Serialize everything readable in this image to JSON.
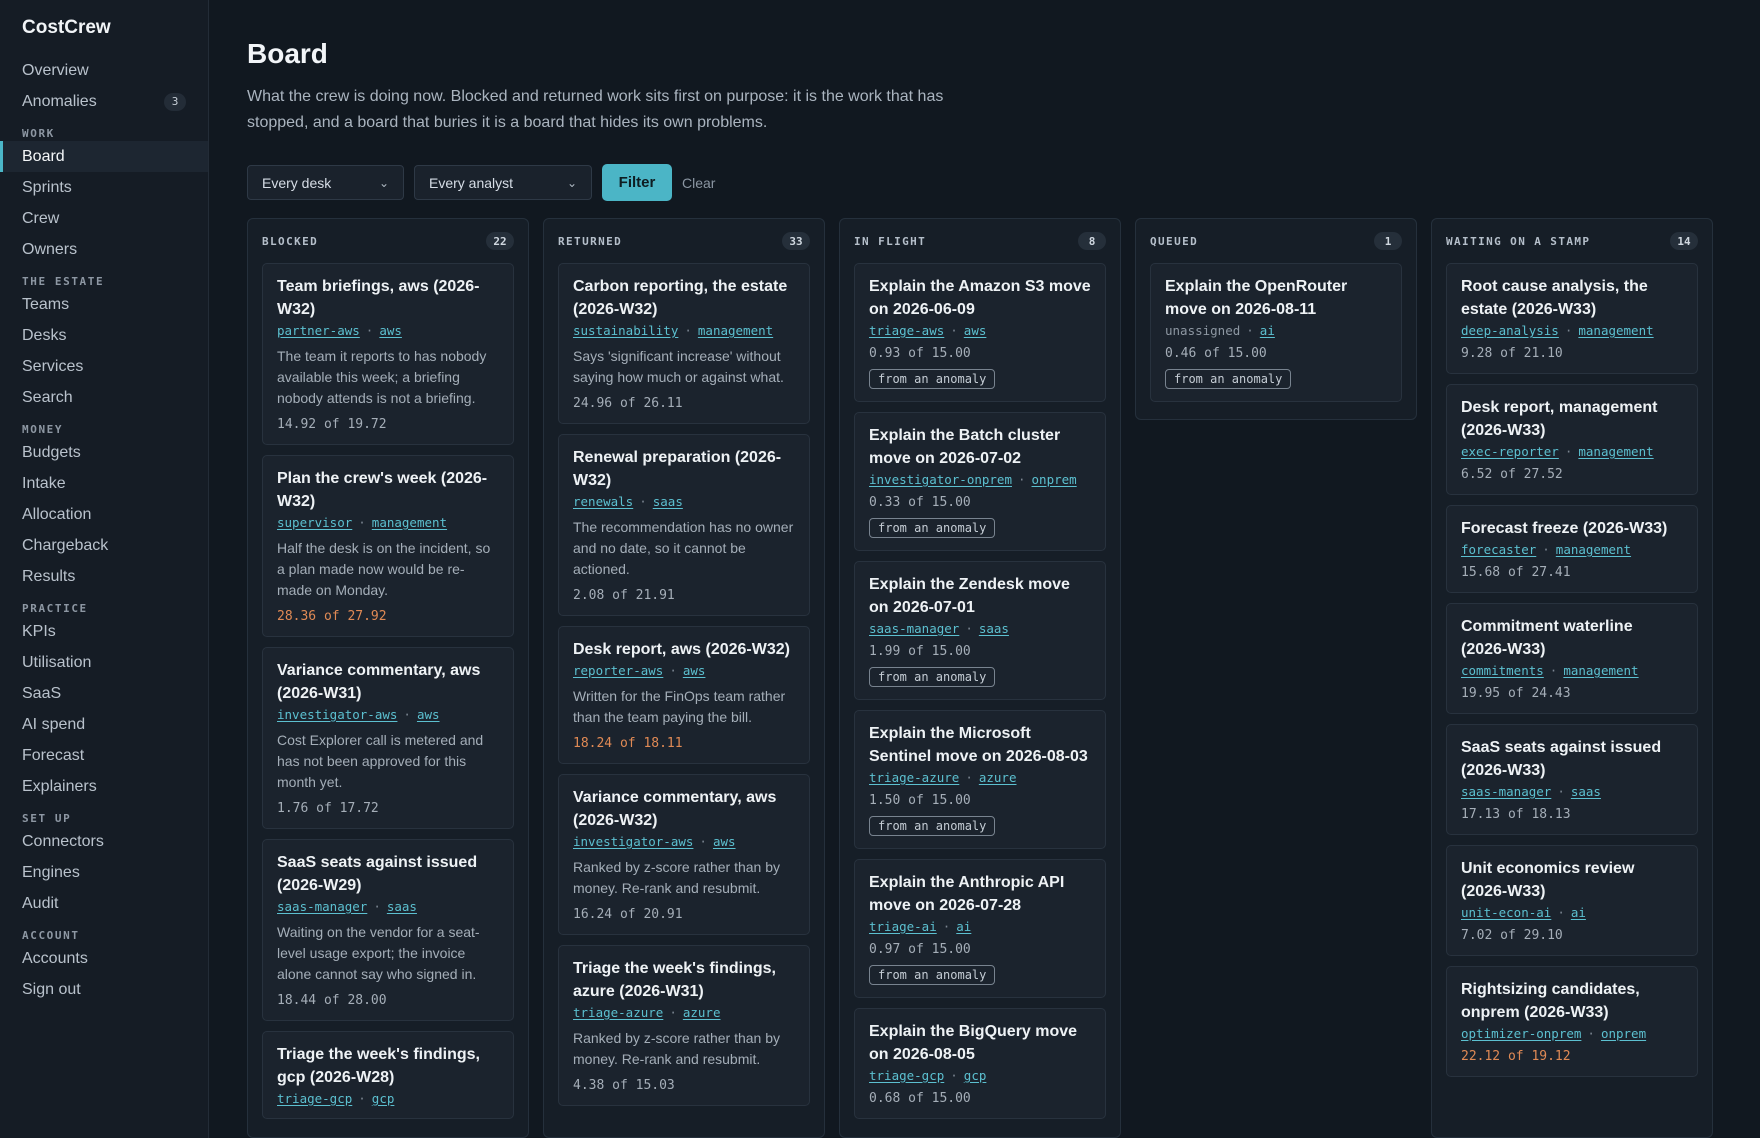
{
  "brand": "CostCrew",
  "nav": {
    "overview": "Overview",
    "anomalies": "Anomalies",
    "anomalies_count": "3",
    "sec_work": "WORK",
    "board": "Board",
    "sprints": "Sprints",
    "crew": "Crew",
    "owners": "Owners",
    "sec_estate": "THE ESTATE",
    "teams": "Teams",
    "desks": "Desks",
    "services": "Services",
    "search": "Search",
    "sec_money": "MONEY",
    "budgets": "Budgets",
    "intake": "Intake",
    "allocation": "Allocation",
    "chargeback": "Chargeback",
    "results": "Results",
    "sec_practice": "PRACTICE",
    "kpis": "KPIs",
    "utilisation": "Utilisation",
    "saas": "SaaS",
    "ai_spend": "AI spend",
    "forecast": "Forecast",
    "explainers": "Explainers",
    "sec_setup": "SET UP",
    "connectors": "Connectors",
    "engines": "Engines",
    "audit": "Audit",
    "sec_account": "ACCOUNT",
    "accounts": "Accounts",
    "sign_out": "Sign out"
  },
  "page": {
    "title": "Board",
    "intro": "What the crew is doing now. Blocked and returned work sits first on purpose: it is the work that has stopped, and a board that buries it is a board that hides its own problems."
  },
  "filters": {
    "desk": "Every desk",
    "analyst": "Every analyst",
    "filter": "Filter",
    "clear": "Clear"
  },
  "columns": [
    {
      "title": "BLOCKED",
      "count": "22",
      "cards": [
        {
          "title": "Team briefings, aws (2026-W32)",
          "owner": "partner-aws",
          "desk": "aws",
          "note": "The team it reports to has nobody available this week; a briefing nobody attends is not a briefing.",
          "amount": "14.92 of 19.72",
          "over": false
        },
        {
          "title": "Plan the crew's week (2026-W32)",
          "owner": "supervisor",
          "desk": "management",
          "note": "Half the desk is on the incident, so a plan made now would be re-made on Monday.",
          "amount": "28.36 of 27.92",
          "over": true
        },
        {
          "title": "Variance commentary, aws (2026-W31)",
          "owner": "investigator-aws",
          "desk": "aws",
          "note": "Cost Explorer call is metered and has not been approved for this month yet.",
          "amount": "1.76 of 17.72",
          "over": false
        },
        {
          "title": "SaaS seats against issued (2026-W29)",
          "owner": "saas-manager",
          "desk": "saas",
          "note": "Waiting on the vendor for a seat-level usage export; the invoice alone cannot say who signed in.",
          "amount": "18.44 of 28.00",
          "over": false
        },
        {
          "title": "Triage the week's findings, gcp (2026-W28)",
          "owner": "triage-gcp",
          "desk": "gcp"
        }
      ]
    },
    {
      "title": "RETURNED",
      "count": "33",
      "cards": [
        {
          "title": "Carbon reporting, the estate (2026-W32)",
          "owner": "sustainability",
          "desk": "management",
          "note": "Says 'significant increase' without saying how much or against what.",
          "amount": "24.96 of 26.11",
          "over": false
        },
        {
          "title": "Renewal preparation (2026-W32)",
          "owner": "renewals",
          "desk": "saas",
          "note": "The recommendation has no owner and no date, so it cannot be actioned.",
          "amount": "2.08 of 21.91",
          "over": false
        },
        {
          "title": "Desk report, aws (2026-W32)",
          "owner": "reporter-aws",
          "desk": "aws",
          "note": "Written for the FinOps team rather than the team paying the bill.",
          "amount": "18.24 of 18.11",
          "over": true
        },
        {
          "title": "Variance commentary, aws (2026-W32)",
          "owner": "investigator-aws",
          "desk": "aws",
          "note": "Ranked by z-score rather than by money. Re-rank and resubmit.",
          "amount": "16.24 of 20.91",
          "over": false
        },
        {
          "title": "Triage the week's findings, azure (2026-W31)",
          "owner": "triage-azure",
          "desk": "azure",
          "note": "Ranked by z-score rather than by money. Re-rank and resubmit.",
          "amount": "4.38 of 15.03",
          "over": false
        }
      ]
    },
    {
      "title": "IN FLIGHT",
      "count": "8",
      "cards": [
        {
          "title": "Explain the Amazon S3 move on 2026-06-09",
          "owner": "triage-aws",
          "desk": "aws",
          "amount": "0.93 of 15.00",
          "pill": "from an anomaly"
        },
        {
          "title": "Explain the Batch cluster move on 2026-07-02",
          "owner": "investigator-onprem",
          "desk": "onprem",
          "amount": "0.33 of 15.00",
          "pill": "from an anomaly"
        },
        {
          "title": "Explain the Zendesk move on 2026-07-01",
          "owner": "saas-manager",
          "desk": "saas",
          "amount": "1.99 of 15.00",
          "pill": "from an anomaly"
        },
        {
          "title": "Explain the Microsoft Sentinel move on 2026-08-03",
          "owner": "triage-azure",
          "desk": "azure",
          "amount": "1.50 of 15.00",
          "pill": "from an anomaly"
        },
        {
          "title": "Explain the Anthropic API move on 2026-07-28",
          "owner": "triage-ai",
          "desk": "ai",
          "amount": "0.97 of 15.00",
          "pill": "from an anomaly"
        },
        {
          "title": "Explain the BigQuery move on 2026-08-05",
          "owner": "triage-gcp",
          "desk": "gcp",
          "amount": "0.68 of 15.00"
        }
      ]
    },
    {
      "title": "QUEUED",
      "count": "1",
      "cards": [
        {
          "title": "Explain the OpenRouter move on 2026-08-11",
          "owner": "unassigned",
          "owner_plain": true,
          "desk": "ai",
          "amount": "0.46 of 15.00",
          "pill": "from an anomaly"
        }
      ]
    },
    {
      "title": "WAITING ON A STAMP",
      "count": "14",
      "cards": [
        {
          "title": "Root cause analysis, the estate (2026-W33)",
          "owner": "deep-analysis",
          "desk": "management",
          "amount": "9.28 of 21.10"
        },
        {
          "title": "Desk report, management (2026-W33)",
          "owner": "exec-reporter",
          "desk": "management",
          "amount": "6.52 of 27.52"
        },
        {
          "title": "Forecast freeze (2026-W33)",
          "owner": "forecaster",
          "desk": "management",
          "amount": "15.68 of 27.41"
        },
        {
          "title": "Commitment waterline (2026-W33)",
          "owner": "commitments",
          "desk": "management",
          "amount": "19.95 of 24.43"
        },
        {
          "title": "SaaS seats against issued (2026-W33)",
          "owner": "saas-manager",
          "desk": "saas",
          "amount": "17.13 of 18.13"
        },
        {
          "title": "Unit economics review (2026-W33)",
          "owner": "unit-econ-ai",
          "desk": "ai",
          "amount": "7.02 of 29.10"
        },
        {
          "title": "Rightsizing candidates, onprem (2026-W33)",
          "owner": "optimizer-onprem",
          "desk": "onprem",
          "amount": "22.12 of 19.12",
          "over": true
        }
      ]
    }
  ]
}
